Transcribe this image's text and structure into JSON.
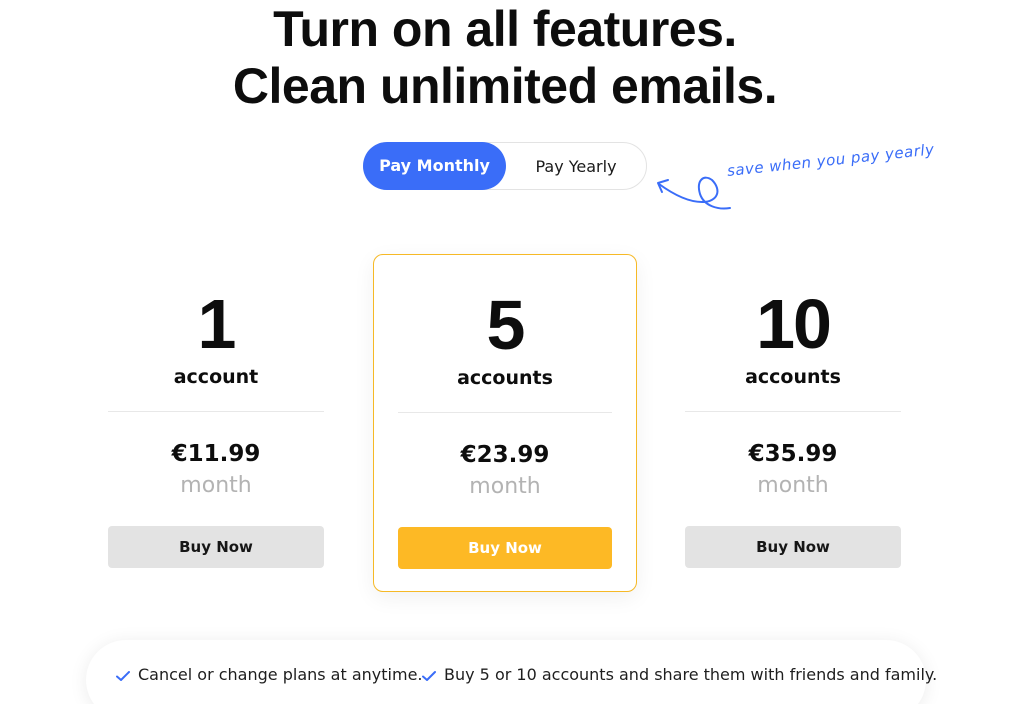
{
  "headline": {
    "line1": "Turn on all features.",
    "line2": "Clean unlimited emails."
  },
  "billing_toggle": {
    "monthly_label": "Pay Monthly",
    "yearly_label": "Pay Yearly",
    "selected": "monthly"
  },
  "annotation": {
    "text": "save when you pay yearly"
  },
  "plans": [
    {
      "count": "1",
      "unit": "account",
      "price": "€11.99",
      "period": "month",
      "button": "Buy Now",
      "featured": false
    },
    {
      "count": "5",
      "unit": "accounts",
      "price": "€23.99",
      "period": "month",
      "button": "Buy Now",
      "featured": true
    },
    {
      "count": "10",
      "unit": "accounts",
      "price": "€35.99",
      "period": "month",
      "button": "Buy Now",
      "featured": false
    }
  ],
  "features": [
    {
      "text": "Cancel or change plans at anytime.",
      "icon": "check-icon"
    },
    {
      "text": "Buy 5 or 10 accounts and share them with friends and family.",
      "icon": "check-icon"
    }
  ],
  "colors": {
    "accent_blue": "#3a6df8",
    "featured_yellow": "#fdb925",
    "featured_border": "#f6b926",
    "button_gray": "#e3e3e3",
    "muted_text": "#b3b3b3"
  }
}
